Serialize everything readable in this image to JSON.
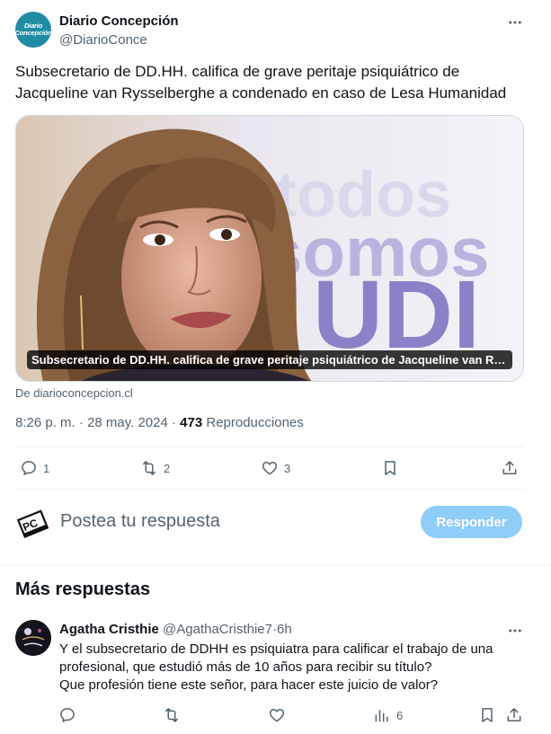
{
  "tweet": {
    "author_name": "Diario Concepción",
    "author_handle": "@DiarioConce",
    "avatar_text_line1": "Diario",
    "avatar_text_line2": "Concepción",
    "text": "Subsecretario de DD.HH. califica de grave peritaje psiquiátrico de Jacqueline van Rysselberghe a condenado en caso de Lesa Humanidad",
    "media_caption": "Subsecretario de DD.HH. califica de grave peritaje psiquiátrico de Jacqueline van Rysselberghe a condenado en caso de Lesa Humanidad",
    "media_backdrop_text": [
      "todos",
      "somos",
      "UDI"
    ],
    "source": "De diarioconcepcion.cl",
    "timestamp": "8:26 p. m. · 28 may. 2024",
    "separator": " · ",
    "views_count": "473",
    "views_label": "Reproducciones",
    "actions": {
      "replies": "1",
      "reposts": "2",
      "likes": "3"
    }
  },
  "composer": {
    "avatar_text": "PC",
    "placeholder": "Postea tu respuesta",
    "button_label": "Responder"
  },
  "more_replies": {
    "title": "Más respuestas",
    "items": [
      {
        "name": "Agatha Cristhie",
        "handle": "@AgathaCristhie7",
        "dot": "·",
        "time": "6h",
        "lines": [
          "Y el subsecretario de DDHH es psiquiatra para calificar el trabajo de una",
          "profesional, que estudió más de 10 años para recibir su título?",
          "Que profesión tiene este señor, para hacer este juicio de valor?"
        ],
        "views": "6"
      }
    ]
  },
  "colors": {
    "accent": "#1d9bf0",
    "button_disabled": "#8ecdf8",
    "text_primary": "#0f1419",
    "text_secondary": "#536471",
    "divider": "#eff3f4"
  },
  "icons": [
    "more-icon",
    "reply-icon",
    "repost-icon",
    "like-icon",
    "bookmark-icon",
    "share-icon",
    "views-icon"
  ]
}
